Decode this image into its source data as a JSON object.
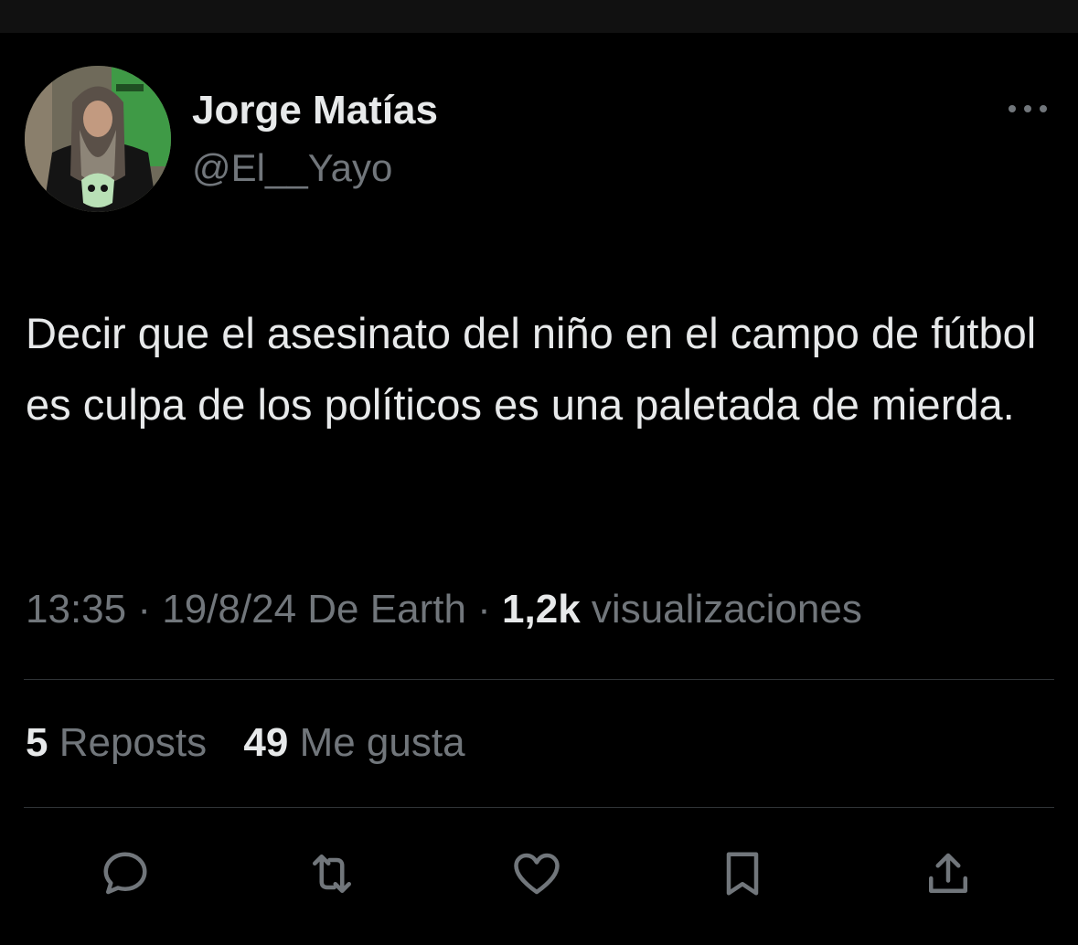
{
  "tweet": {
    "author": {
      "name": "Jorge Matías",
      "handle": "@El__Yayo"
    },
    "text": "Decir que el asesinato del niño en el campo de fútbol es culpa de los políticos es una paletada de mierda.",
    "meta": {
      "time": "13:35",
      "date": "19/8/24",
      "source": "De Earth",
      "separator": "·",
      "views_count": "1,2k",
      "views_label": "visualizaciones"
    },
    "stats": {
      "reposts_count": "5",
      "reposts_label": "Reposts",
      "likes_count": "49",
      "likes_label": "Me gusta"
    }
  },
  "actions": [
    {
      "name": "reply",
      "icon": "reply-icon"
    },
    {
      "name": "repost",
      "icon": "repost-icon"
    },
    {
      "name": "like",
      "icon": "like-icon"
    },
    {
      "name": "bookmark",
      "icon": "bookmark-icon"
    },
    {
      "name": "share",
      "icon": "share-icon"
    }
  ],
  "colors": {
    "background": "#000000",
    "primary_text": "#e7e9ea",
    "secondary_text": "#71767b",
    "divider": "#2f3336"
  }
}
